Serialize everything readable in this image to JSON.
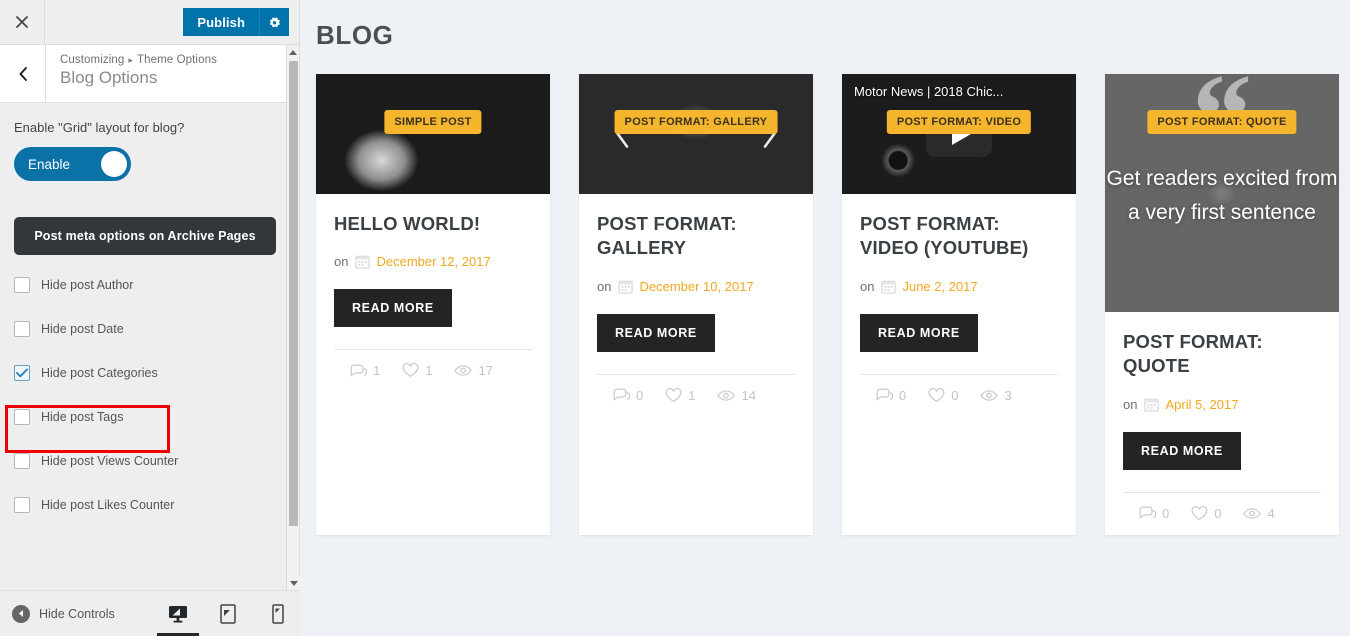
{
  "customizer": {
    "close_icon": "close-icon",
    "publish_label": "Publish",
    "gear_icon": "gear-icon",
    "back_icon": "chevron-left-icon",
    "breadcrumb": {
      "root": "Customizing",
      "separator": "▸",
      "parent": "Theme Options"
    },
    "panel_title": "Blog Options",
    "grid_control": {
      "label": "Enable \"Grid\" layout for blog?",
      "toggle_label": "Enable",
      "state": "on"
    },
    "section_heading": "Post meta options on Archive Pages",
    "checkboxes": [
      {
        "label": "Hide post Author",
        "checked": false
      },
      {
        "label": "Hide post Date",
        "checked": false
      },
      {
        "label": "Hide post Categories",
        "checked": true,
        "highlighted": true
      },
      {
        "label": "Hide post Tags",
        "checked": false
      },
      {
        "label": "Hide post Views Counter",
        "checked": false
      },
      {
        "label": "Hide post Likes Counter",
        "checked": false
      }
    ],
    "footer": {
      "hide_controls_label": "Hide Controls",
      "devices": [
        {
          "name": "desktop",
          "active": true
        },
        {
          "name": "tablet",
          "active": false
        },
        {
          "name": "mobile",
          "active": false
        }
      ]
    },
    "colors": {
      "publish_blue": "#0073aa",
      "toggle_blue": "#0b72a8",
      "section_dark": "#32373c",
      "annotation_red": "#ee0000"
    }
  },
  "preview": {
    "page_title": "BLOG",
    "accent_amber": "#f5b52c",
    "date_amber": "#f0a81f",
    "read_more_label": "READ MORE",
    "on_prefix": "on",
    "posts": [
      {
        "badge": "SIMPLE POST",
        "title": "HELLO WORLD!",
        "date": "December 12, 2017",
        "format": "simple",
        "thumb_height": "short",
        "comments": "1",
        "likes": "1",
        "views": "17"
      },
      {
        "badge": "POST FORMAT: GALLERY",
        "title": "POST FORMAT: GALLERY",
        "date": "December 10, 2017",
        "format": "gallery",
        "thumb_height": "short",
        "comments": "0",
        "likes": "1",
        "views": "14"
      },
      {
        "badge": "POST FORMAT: VIDEO",
        "title": "POST FORMAT: VIDEO (YOUTUBE)",
        "date": "June 2, 2017",
        "format": "video",
        "video_title": "Motor News | 2018 Chic...",
        "thumb_height": "short",
        "comments": "0",
        "likes": "0",
        "views": "3"
      },
      {
        "badge": "POST FORMAT: QUOTE",
        "title": "POST FORMAT: QUOTE",
        "date": "April 5, 2017",
        "format": "quote",
        "quote_text": "Get readers excited from a very first sentence",
        "thumb_height": "tall",
        "comments": "0",
        "likes": "0",
        "views": "4"
      }
    ]
  }
}
